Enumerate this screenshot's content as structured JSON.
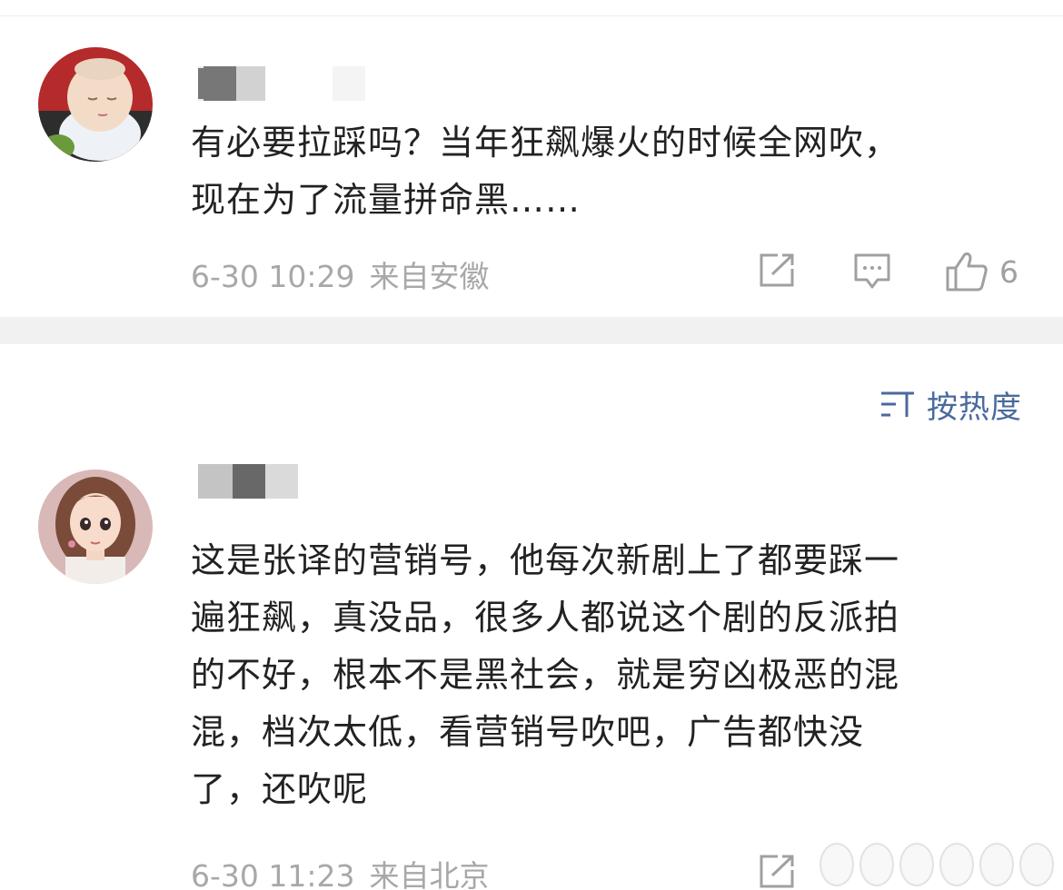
{
  "comments": [
    {
      "text_line1": "有必要拉踩吗？当年狂飙爆火的时候全网吹，",
      "text_line2": "现在为了流量拼命黑……",
      "time": "6-30 10:29",
      "location": "来自安徽",
      "likes": "6",
      "avatar_icon": "baby-photo"
    },
    {
      "text_lines": [
        "这是张译的营销号，他每次新剧上了都要踩一",
        "遍狂飙，真没品，很多人都说这个剧的反派拍",
        "的不好，根本不是黑社会，就是穷凶极恶的混",
        "混，档次太低，看营销号吹吧，广告都快没",
        "了，还吹呢"
      ],
      "time": "6-30 11:23",
      "location": "来自北京",
      "avatar_icon": "cartoon-girl"
    }
  ],
  "sort": {
    "label": "按热度",
    "icon": "sort-lines-icon"
  },
  "colors": {
    "text": "#222222",
    "meta": "#a8a8a8",
    "accent": "#4a6a9e",
    "divider": "#f1f1f1"
  }
}
